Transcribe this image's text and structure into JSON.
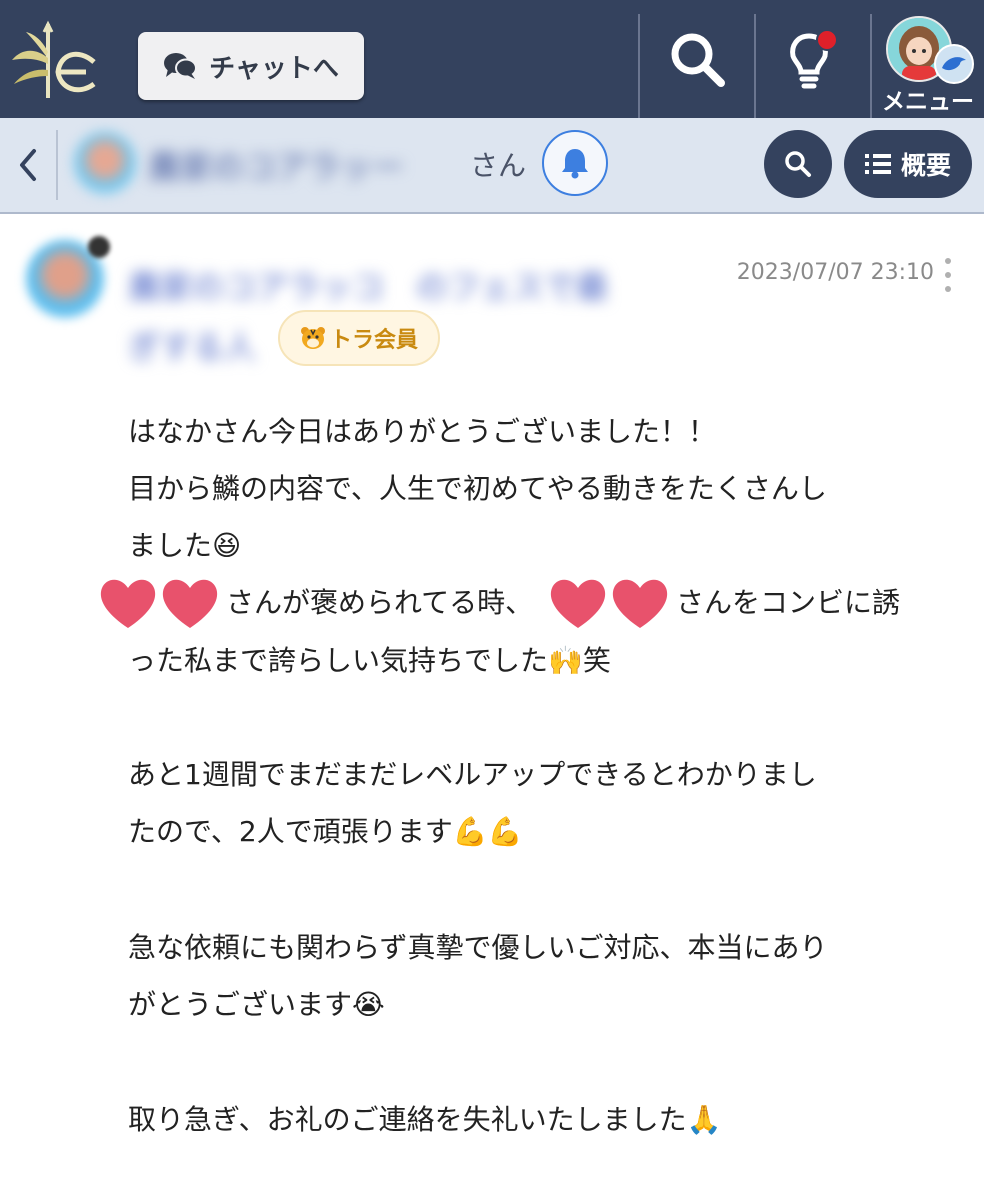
{
  "header": {
    "chat_button_label": "チャットへ",
    "menu_label": "メニュー"
  },
  "subheader": {
    "channel_name": "農家のコアラッー",
    "name_suffix": "さん",
    "overview_label": "概要"
  },
  "post": {
    "username_line1": "農家のコアラッコ　のフェスで最",
    "username_line2": "ぎする人",
    "badge_label": "トラ会員",
    "timestamp": "2023/07/07 23:10",
    "lines": [
      "はなかさん今日はありがとうございました！！",
      "目から鱗の内容で、人生で初めてやる動きをたくさんし",
      "ました😆",
      "さんが褒められてる時、",
      "さんをコンビに誘",
      "った私まで誇らしい気持ちでした🙌笑",
      "あと1週間でまだまだレベルアップできるとわかりまし",
      "たので、2人で頑張ります💪💪",
      "急な依頼にも関わらず真摯で優しいご対応、本当にあり",
      "がとうございます😭",
      "取り急ぎ、お礼のご連絡を失礼いたしました🙏"
    ]
  },
  "icons": {
    "logo": "bamboo-logo-icon",
    "search": "search-icon",
    "notifications": "lightbulb-icon",
    "bell": "bell-icon",
    "overview": "list-icon",
    "back": "chevron-left-icon",
    "more": "more-vertical-icon"
  },
  "colors": {
    "header_bg": "#34425e",
    "subheader_bg": "#dde5f0",
    "accent_blue": "#3d7fe0",
    "notification_dot": "#e0202a",
    "badge_text": "#c98a10"
  }
}
